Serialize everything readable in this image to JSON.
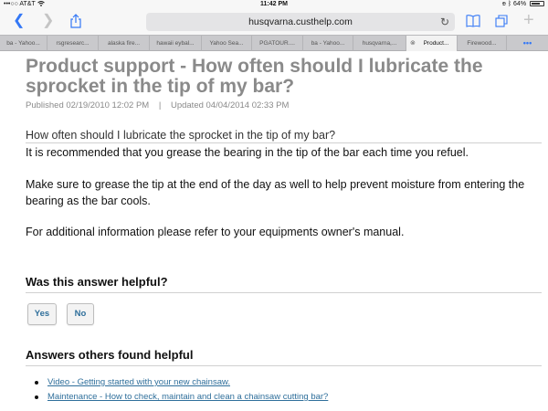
{
  "status_bar": {
    "carrier": "•••○○ AT&T",
    "wifi_icon": "wifi-icon",
    "time": "11:42 PM",
    "bluetooth_icon": "bluetooth-icon",
    "battery_text": "64%",
    "battery_level": 0.64
  },
  "toolbar": {
    "url": "husqvarna.custhelp.com",
    "back_icon": "chevron-left-icon",
    "forward_icon": "chevron-right-icon",
    "share_icon": "share-icon",
    "reload_icon": "reload-icon",
    "bookmarks_icon": "book-icon",
    "tabs_icon": "tabs-icon",
    "new_tab_icon": "plus-icon"
  },
  "tabs": [
    {
      "label": "ba - Yahoo..."
    },
    {
      "label": "rsgresearc..."
    },
    {
      "label": "alaska fire..."
    },
    {
      "label": "hawaii eybal..."
    },
    {
      "label": "Yahoo Sea..."
    },
    {
      "label": "PGATOUR...."
    },
    {
      "label": "ba - Yahoo..."
    },
    {
      "label": "husqvarna,..."
    },
    {
      "label": "Product..."
    },
    {
      "label": "Firewood..."
    },
    {
      "label": "•••"
    }
  ],
  "article": {
    "title": "Product support - How often should I lubricate the sprocket in the tip of my bar?",
    "published": "Published 02/19/2010 12:02 PM",
    "separator": "|",
    "updated": "Updated 04/04/2014 02:33 PM",
    "question": "How often should I lubricate the sprocket in the tip of my bar?",
    "paragraphs": [
      "It is recommended that you grease the bearing in the tip of the bar each time you refuel.",
      "Make sure to grease the tip at the end of the day as well to help prevent moisture from entering the bearing as the bar cools.",
      "For additional information please refer to your equipments owner's manual."
    ]
  },
  "feedback": {
    "heading": "Was this answer helpful?",
    "yes_label": "Yes",
    "no_label": "No"
  },
  "related": {
    "heading": "Answers others found helpful",
    "items": [
      "Video - Getting started with your new chainsaw.",
      "Maintenance - How to check, maintain and clean a chainsaw cutting bar?"
    ]
  },
  "colors": {
    "ios_blue": "#3478f6",
    "link_blue": "#2f6f9b",
    "title_gray": "#8a8a8a"
  }
}
